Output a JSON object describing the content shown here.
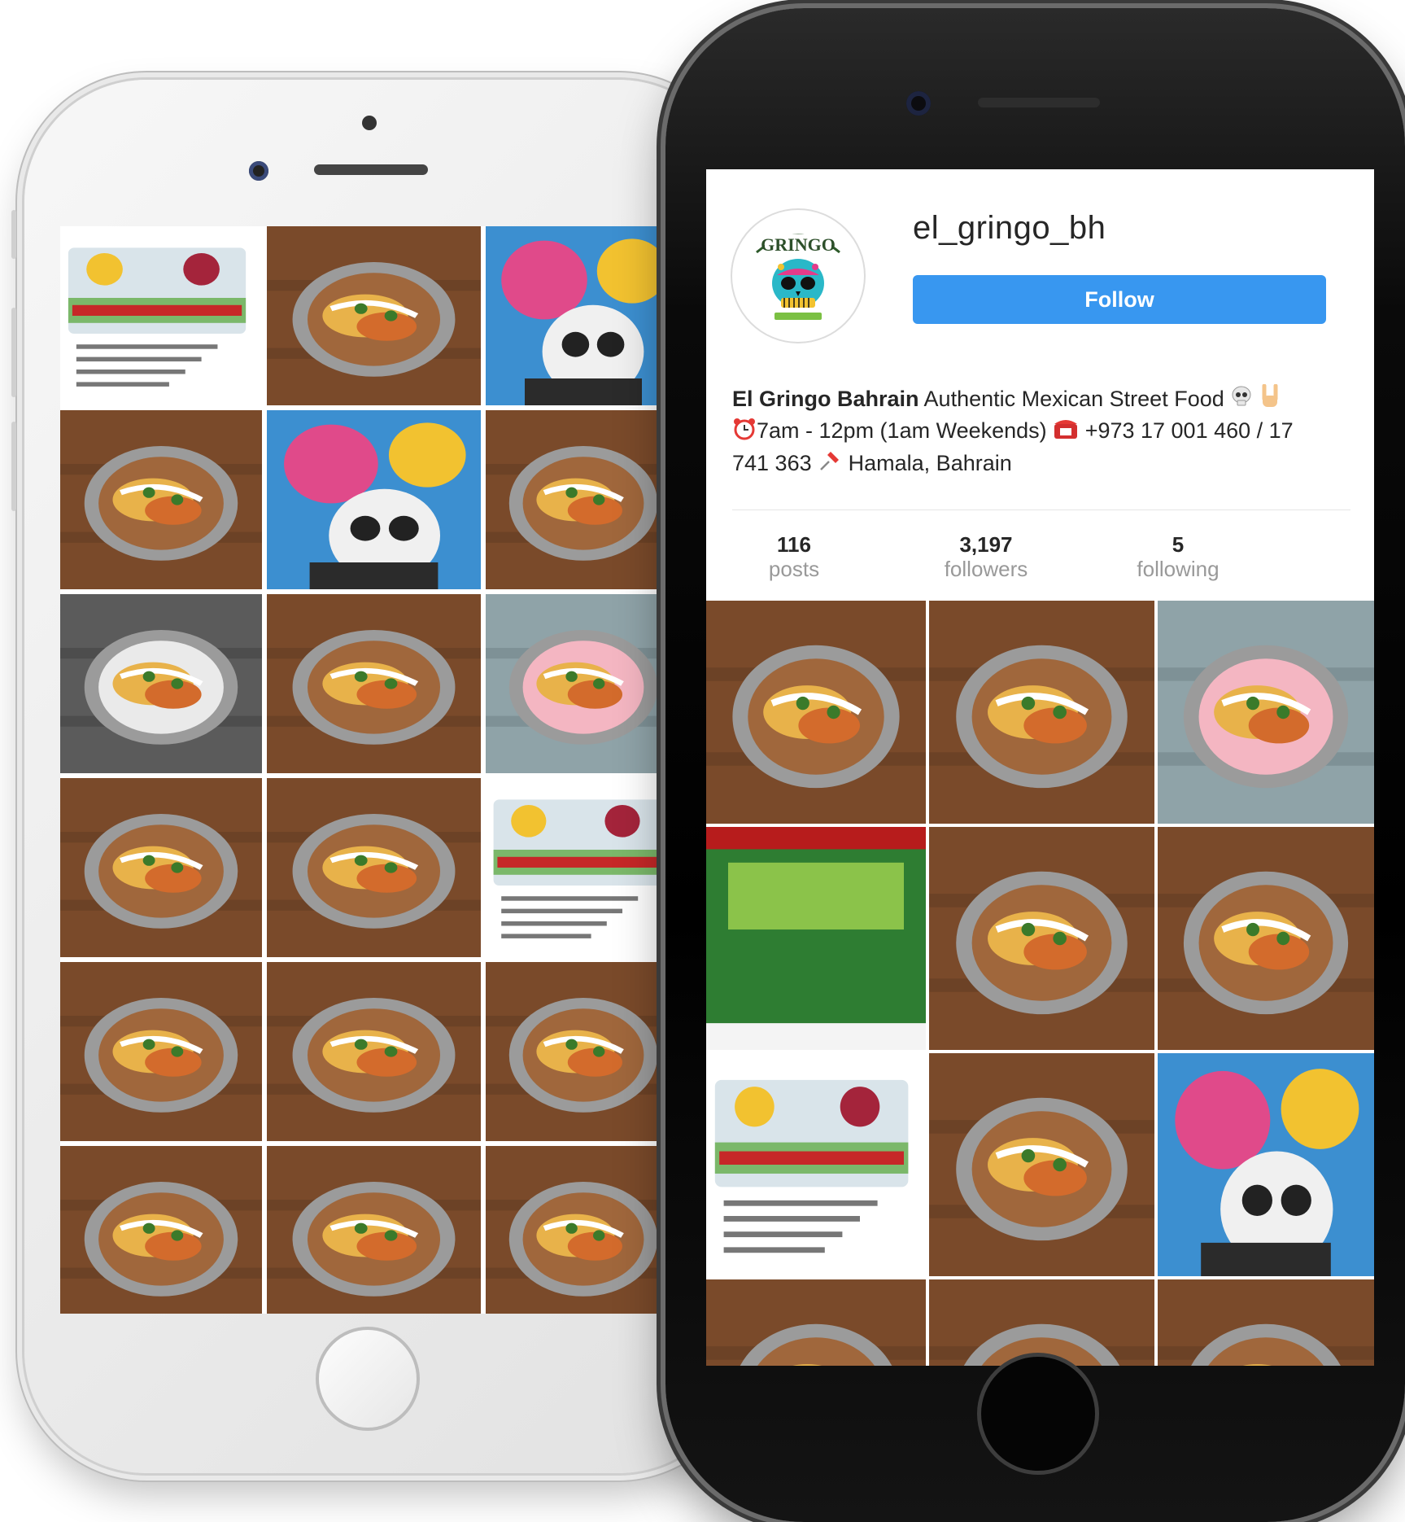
{
  "profile": {
    "username": "el_gringo_bh",
    "follow_label": "Follow",
    "avatar_icon": "skull-logo-icon",
    "bio": {
      "name": "El Gringo Bahrain",
      "line1": "Authentic Mexican Street Food",
      "hours": "7am - 12pm (1am Weekends)",
      "phone": "+973 17 001 460 / 17 741 363",
      "location": "Hamala, Bahrain"
    },
    "stats": [
      {
        "value": "116",
        "label": "posts"
      },
      {
        "value": "3,197",
        "label": "followers"
      },
      {
        "value": "5",
        "label": "following"
      }
    ]
  },
  "colors": {
    "follow_button": "#3897f0",
    "text_primary": "#262626",
    "text_secondary": "#999999"
  },
  "white_phone_posts": [
    {
      "name": "post-match-flyer-villarreal-barca"
    },
    {
      "name": "post-nachos-guacamole"
    },
    {
      "name": "post-staff-group"
    },
    {
      "name": "post-enchiladas"
    },
    {
      "name": "post-skull-mural"
    },
    {
      "name": "post-tacos-bucket"
    },
    {
      "name": "post-chef-burrito"
    },
    {
      "name": "post-churros"
    },
    {
      "name": "post-pink-drink"
    },
    {
      "name": "post-fajita-skillet"
    },
    {
      "name": "post-tacos-tray"
    },
    {
      "name": "post-match-flyer-atletico-madrid"
    },
    {
      "name": "post-soft-tacos"
    },
    {
      "name": "post-ribs"
    },
    {
      "name": "post-table-spread"
    },
    {
      "name": "post-partial-1"
    },
    {
      "name": "post-partial-2"
    },
    {
      "name": "post-partial-3"
    }
  ],
  "black_phone_posts": [
    {
      "name": "post-taquitos"
    },
    {
      "name": "post-tacos-pins"
    },
    {
      "name": "post-nachos-drinks"
    },
    {
      "name": "post-gringo-stadium-screen"
    },
    {
      "name": "post-enchiladas-tray"
    },
    {
      "name": "post-burrito-hand"
    },
    {
      "name": "post-match-flyer-villarreal-barca"
    },
    {
      "name": "post-nachos-guacamole"
    },
    {
      "name": "post-staff-group"
    },
    {
      "name": "post-partial-1"
    },
    {
      "name": "post-partial-2"
    },
    {
      "name": "post-partial-3"
    }
  ]
}
